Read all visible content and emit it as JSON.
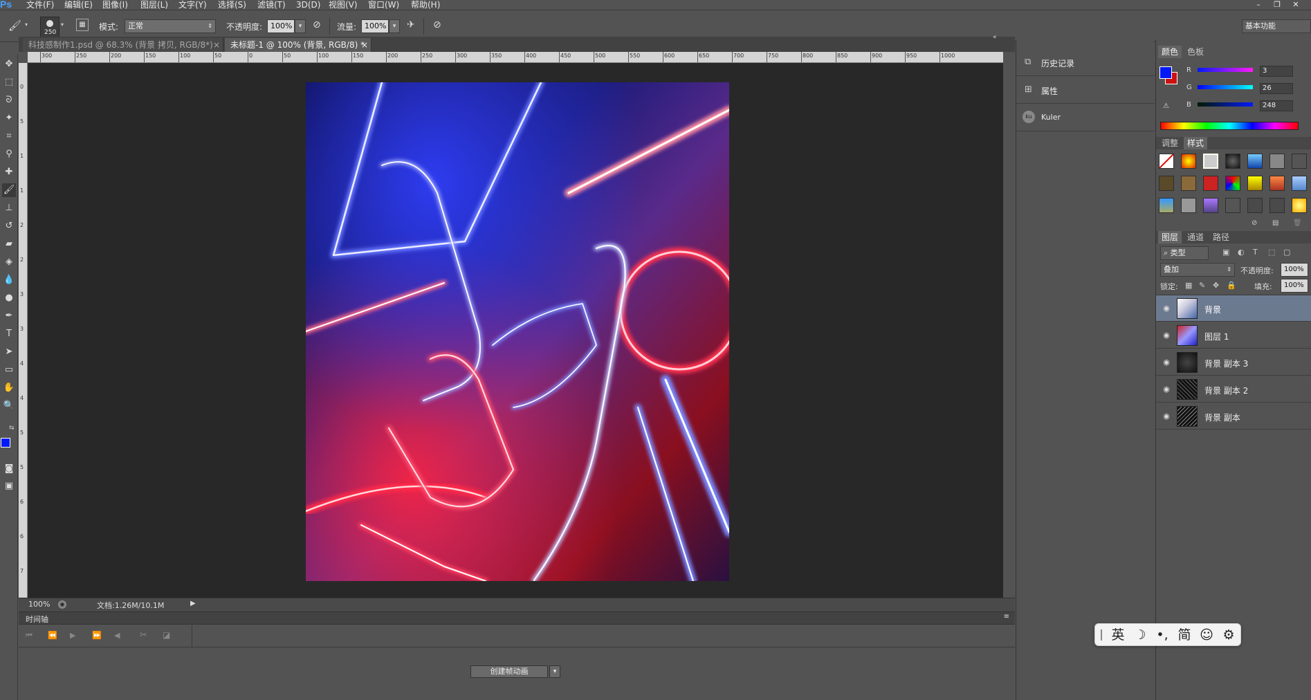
{
  "app": {
    "logo": "Ps"
  },
  "menu": [
    "文件(F)",
    "编辑(E)",
    "图像(I)",
    "图层(L)",
    "文字(Y)",
    "选择(S)",
    "滤镜(T)",
    "3D(D)",
    "视图(V)",
    "窗口(W)",
    "帮助(H)"
  ],
  "window_buttons": [
    "–",
    "❐",
    "✕"
  ],
  "options_bar": {
    "brush_size": "250",
    "mode_label": "模式:",
    "mode_value": "正常",
    "opacity_label": "不透明度:",
    "opacity_value": "100%",
    "flow_label": "流量:",
    "flow_value": "100%",
    "workspace": "基本功能"
  },
  "doc_tabs": [
    {
      "label": "科技感制作1.psd @ 68.3% (背景 拷贝, RGB/8*)",
      "close": "×"
    },
    {
      "label": "未标题-1 @ 100% (背景, RGB/8) *",
      "close": "×"
    }
  ],
  "ruler_h": [
    "300",
    "250",
    "200",
    "150",
    "100",
    "50",
    "0",
    "50",
    "100",
    "150",
    "200",
    "250",
    "300",
    "350",
    "400",
    "450",
    "500",
    "550",
    "600",
    "650",
    "700",
    "750",
    "800",
    "850",
    "900",
    "950",
    "1000"
  ],
  "ruler_v": [
    "0",
    "5",
    "1",
    "1",
    "2",
    "2",
    "3",
    "3",
    "4",
    "4",
    "5",
    "5",
    "6",
    "6",
    "7"
  ],
  "status": {
    "zoom": "100%",
    "doc": "文档:1.26M/10.1M"
  },
  "timeline": {
    "title": "时间轴",
    "create_btn": "创建帧动画"
  },
  "mid_panel": [
    {
      "label": "历史记录",
      "icon": "history-icon"
    },
    {
      "label": "属性",
      "icon": "properties-icon"
    },
    {
      "label": "Kuler",
      "icon": "kuler-icon"
    }
  ],
  "color_panel": {
    "tabs": [
      "颜色",
      "色板"
    ],
    "r_label": "R",
    "r": "3",
    "g_label": "G",
    "g": "26",
    "b_label": "B",
    "b": "248",
    "fg": "#0319f8",
    "bg": "#cc1111"
  },
  "styles_panel": {
    "tabs": [
      "调整",
      "样式"
    ]
  },
  "layers_panel": {
    "tabs": [
      "图层",
      "通道",
      "路径"
    ],
    "filter": "类型",
    "blend": "叠加",
    "opacity_label": "不透明度:",
    "opacity": "100%",
    "lock_label": "锁定:",
    "fill_label": "填充:",
    "fill": "100%",
    "layers": [
      {
        "name": "背景",
        "selected": true
      },
      {
        "name": "图层 1",
        "selected": false
      },
      {
        "name": "背景 副本 3",
        "selected": false
      },
      {
        "name": "背景 副本 2",
        "selected": false
      },
      {
        "name": "背景 副本",
        "selected": false
      }
    ]
  },
  "ime": {
    "items": [
      "英",
      "☽",
      "•,",
      "简",
      "☺",
      "⚙"
    ]
  }
}
